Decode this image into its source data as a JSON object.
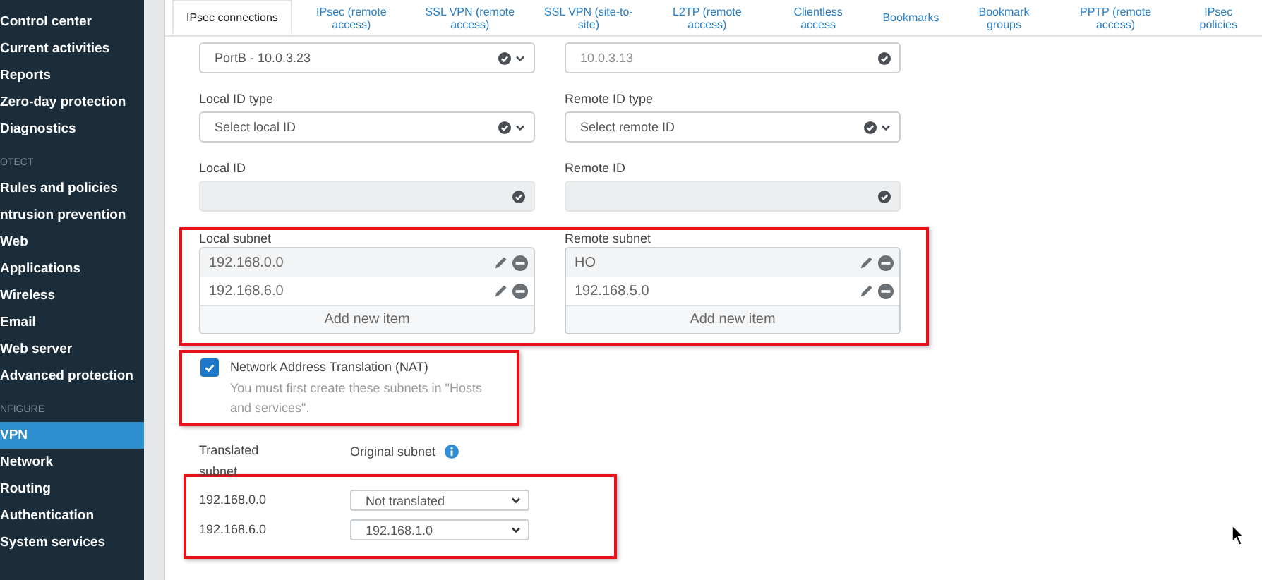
{
  "sidebar": {
    "items": [
      {
        "kind": "item",
        "label": "Control center",
        "selected": false
      },
      {
        "kind": "item",
        "label": "Current activities",
        "selected": false
      },
      {
        "kind": "item",
        "label": "Reports",
        "selected": false
      },
      {
        "kind": "item",
        "label": "Zero-day protection",
        "selected": false
      },
      {
        "kind": "item",
        "label": "Diagnostics",
        "selected": false
      },
      {
        "kind": "header",
        "label": "OTECT"
      },
      {
        "kind": "item",
        "label": "Rules and policies",
        "selected": false
      },
      {
        "kind": "item",
        "label": "ntrusion prevention",
        "selected": false
      },
      {
        "kind": "item",
        "label": "Web",
        "selected": false
      },
      {
        "kind": "item",
        "label": "Applications",
        "selected": false
      },
      {
        "kind": "item",
        "label": "Wireless",
        "selected": false
      },
      {
        "kind": "item",
        "label": "Email",
        "selected": false
      },
      {
        "kind": "item",
        "label": "Web server",
        "selected": false
      },
      {
        "kind": "item",
        "label": "Advanced protection",
        "selected": false
      },
      {
        "kind": "header",
        "label": "NFIGURE"
      },
      {
        "kind": "item",
        "label": "VPN",
        "selected": true
      },
      {
        "kind": "item",
        "label": "Network",
        "selected": false
      },
      {
        "kind": "item",
        "label": "Routing",
        "selected": false
      },
      {
        "kind": "item",
        "label": "Authentication",
        "selected": false
      },
      {
        "kind": "item",
        "label": "System services",
        "selected": false
      }
    ]
  },
  "tabs": [
    {
      "label": "IPsec connections",
      "selected": true
    },
    {
      "label": "IPsec (remote access)",
      "selected": false
    },
    {
      "label": "SSL VPN (remote access)",
      "selected": false
    },
    {
      "label": "SSL VPN (site-to-site)",
      "selected": false
    },
    {
      "label": "L2TP (remote access)",
      "selected": false
    },
    {
      "label": "Clientless access",
      "selected": false
    },
    {
      "label": "Bookmarks",
      "selected": false
    },
    {
      "label": "Bookmark groups",
      "selected": false
    },
    {
      "label": "PPTP (remote access)",
      "selected": false
    },
    {
      "label": "IPsec policies",
      "selected": false
    }
  ],
  "field_rows": [
    [
      {
        "kind": "select",
        "value": "PortB - 10.0.3.23"
      },
      {
        "kind": "text",
        "value": "10.0.3.13"
      }
    ],
    [
      {
        "kind": "select",
        "label": "Local ID type",
        "placeholder": "Select local ID"
      },
      {
        "kind": "select",
        "label": "Remote ID type",
        "placeholder": "Select remote ID"
      }
    ],
    [
      {
        "kind": "readonly",
        "label": "Local ID"
      },
      {
        "kind": "readonly",
        "label": "Remote ID"
      }
    ]
  ],
  "subnets": [
    {
      "label": "Local subnet",
      "items": [
        "192.168.0.0",
        "192.168.6.0"
      ],
      "add_label": "Add new item"
    },
    {
      "label": "Remote subnet",
      "items": [
        "HO",
        "192.168.5.0"
      ],
      "add_label": "Add new item"
    }
  ],
  "nat": {
    "checked": true,
    "label": "Network Address Translation (NAT)",
    "hint": "You must first create these subnets in \"Hosts and services\"."
  },
  "translation": {
    "headers": [
      "Translated subnet",
      "Original subnet"
    ],
    "rows": [
      {
        "translated": "192.168.0.0",
        "original": "Not translated"
      },
      {
        "translated": "192.168.6.0",
        "original": "192.168.1.0"
      }
    ]
  }
}
